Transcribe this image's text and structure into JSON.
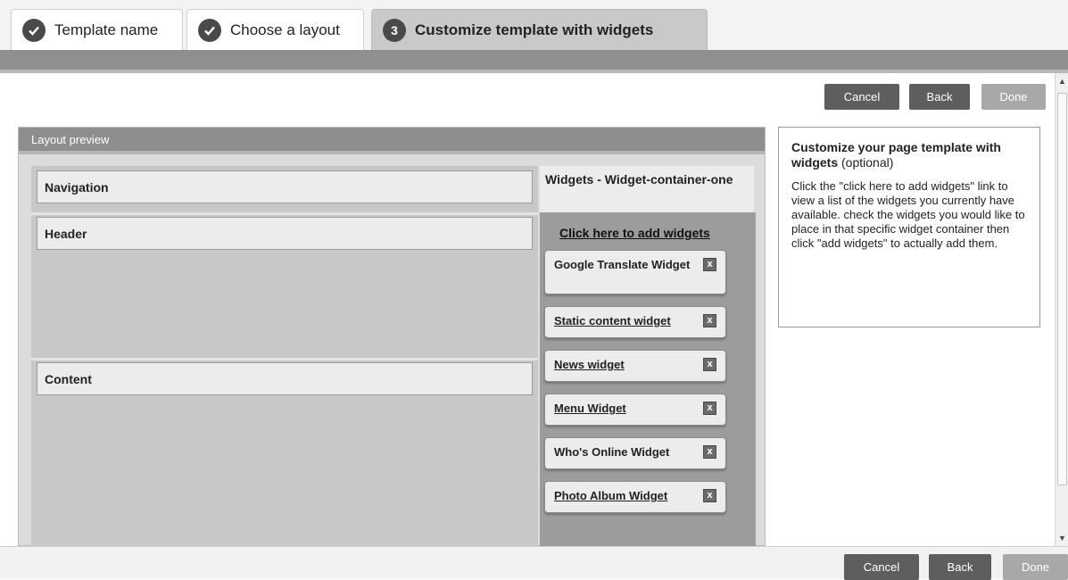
{
  "tabs": [
    {
      "label": "Template name",
      "icon": "check-icon"
    },
    {
      "label": "Choose a layout",
      "icon": "check-icon"
    },
    {
      "label": "Customize template with widgets",
      "step": "3"
    }
  ],
  "top_actions": {
    "cancel": "Cancel",
    "back": "Back",
    "done": "Done"
  },
  "bottom_actions": {
    "cancel": "Cancel",
    "back": "Back",
    "done": "Done"
  },
  "preview": {
    "title": "Layout preview",
    "zones": [
      "Navigation",
      "Header",
      "Content"
    ],
    "widgets_title": "Widgets - Widget-container-one",
    "add_link": "Click here to add widgets",
    "remove_glyph": "x",
    "widgets": [
      "Google Translate Widget",
      "Static content widget",
      "News widget",
      "Menu Widget",
      "Who's Online Widget",
      "Photo Album Widget"
    ]
  },
  "help": {
    "heading": "Customize your page template with widgets",
    "optional": "(optional)",
    "body": "Click the \"click here to add widgets\" link to view a list of the widgets you currently have available. check the widgets you would like to place in that specific widget container then click \"add widgets\" to actually add them."
  }
}
